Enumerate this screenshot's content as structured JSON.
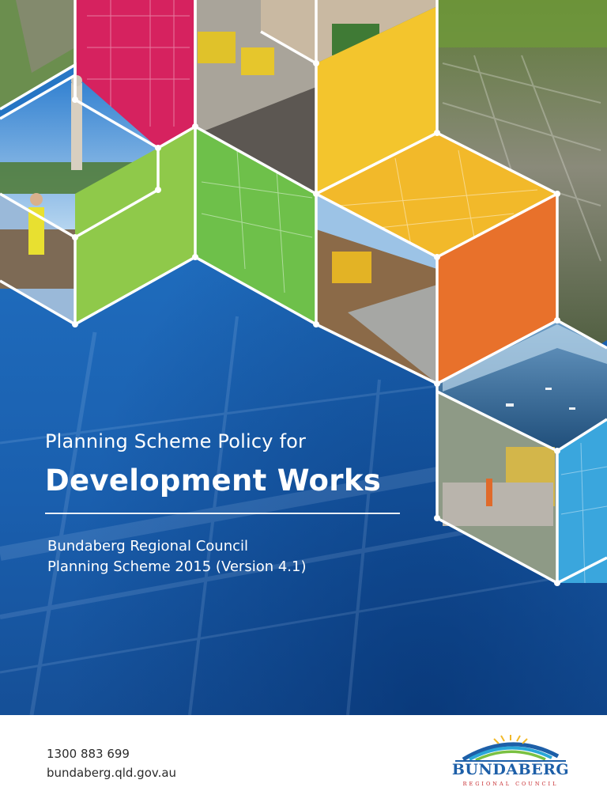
{
  "cover": {
    "subtitle": "Planning Scheme Policy for",
    "title": "Development Works",
    "council_line1": "Bundaberg Regional Council",
    "council_line2": "Planning Scheme 2015 (Version 4.1)"
  },
  "footer": {
    "phone": "1300 883 699",
    "website": "bundaberg.qld.gov.au"
  },
  "logo": {
    "wordmark": "BUNDABERG",
    "tagline": "REGIONAL COUNCIL"
  },
  "colors": {
    "cover_blue": "#1f6cbd",
    "magenta": "#d6225f",
    "green": "#8fc94a",
    "yellow": "#f3c52d",
    "orange": "#e8712b",
    "light_blue": "#3aa6dd",
    "logo_blue": "#1d5fa8",
    "logo_red": "#c6282c"
  }
}
